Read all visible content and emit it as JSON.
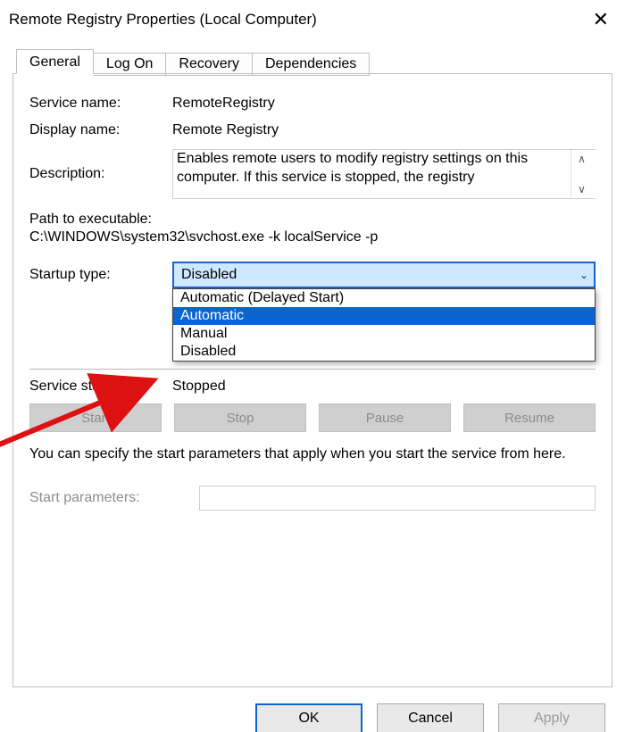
{
  "window": {
    "title": "Remote Registry Properties (Local Computer)"
  },
  "tabs": [
    "General",
    "Log On",
    "Recovery",
    "Dependencies"
  ],
  "general": {
    "service_name_label": "Service name:",
    "service_name": "RemoteRegistry",
    "display_name_label": "Display name:",
    "display_name": "Remote Registry",
    "description_label": "Description:",
    "description": "Enables remote users to modify registry settings on this computer. If this service is stopped, the registry",
    "path_label": "Path to executable:",
    "path": "C:\\WINDOWS\\system32\\svchost.exe -k localService -p",
    "startup_label": "Startup type:",
    "startup_selected": "Disabled",
    "startup_options": [
      "Automatic (Delayed Start)",
      "Automatic",
      "Manual",
      "Disabled"
    ],
    "startup_highlighted_index": 1,
    "service_status_label": "Service status:",
    "service_status": "Stopped",
    "buttons": {
      "start": "Start",
      "stop": "Stop",
      "pause": "Pause",
      "resume": "Resume"
    },
    "note": "You can specify the start parameters that apply when you start the service from here.",
    "start_params_label": "Start parameters:",
    "start_params_value": ""
  },
  "dialog_buttons": {
    "ok": "OK",
    "cancel": "Cancel",
    "apply": "Apply"
  }
}
